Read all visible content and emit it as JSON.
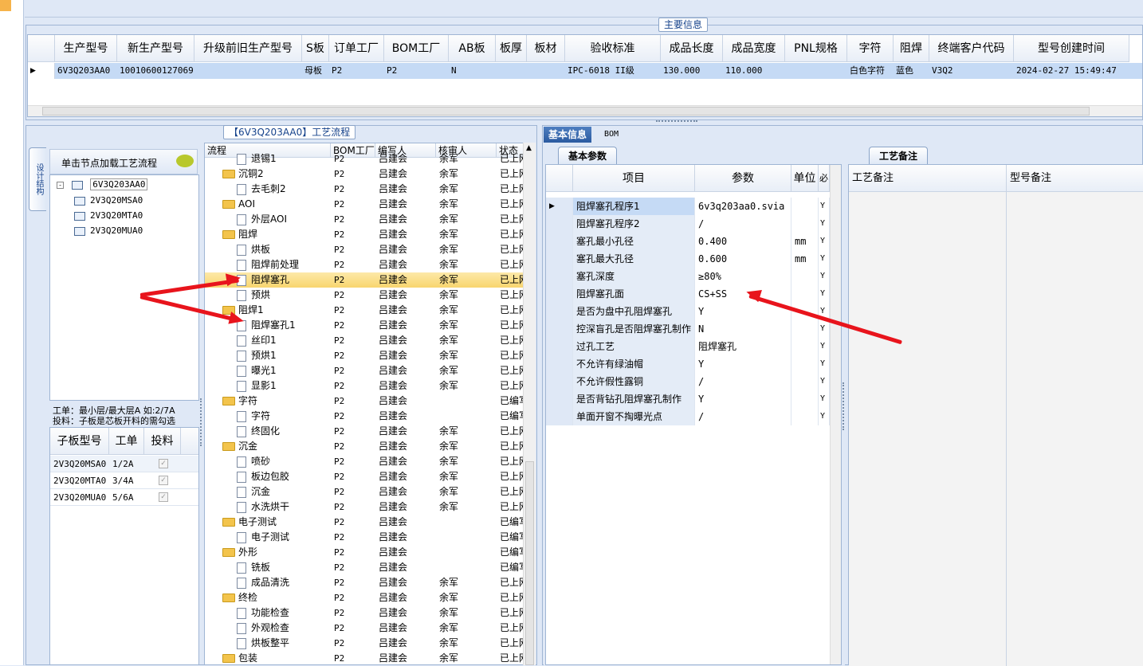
{
  "main_group": {
    "title": "主要信息"
  },
  "main_grid": {
    "headers": [
      "生产型号",
      "新生产型号",
      "升级前旧生产型号",
      "S板",
      "订单工厂",
      "BOM工厂",
      "AB板",
      "板厚",
      "板材",
      "验收标准",
      "成品长度",
      "成品宽度",
      "PNL规格",
      "字符",
      "阻焊",
      "终端客户代码",
      "型号创建时间"
    ],
    "row": [
      "6V3Q203AA0",
      "10010600127069",
      "",
      "母板",
      "P2",
      "P2",
      "N",
      "",
      "",
      "IPC-6018 II级",
      "130.000",
      "110.000",
      "",
      "白色字符",
      "蓝色",
      "V3Q2",
      "2024-02-27 15:49:47"
    ]
  },
  "process_group": {
    "title": "【6V3Q203AA0】工艺流程"
  },
  "side_tab": {
    "label": "设计结构"
  },
  "load_hint": "单击节点加载工艺流程",
  "tree": {
    "root": "6V3Q203AA0",
    "children": [
      "2V3Q20MSA0",
      "2V3Q20MTA0",
      "2V3Q20MUA0"
    ]
  },
  "note": {
    "line1": "工单：最小层/最大层A 如:2/7A",
    "line2": "投料：子板是芯板开料的需勾选"
  },
  "sub_grid": {
    "headers": [
      "子板型号",
      "工单",
      "投料"
    ],
    "rows": [
      [
        "2V3Q20MSA0",
        "1/2A"
      ],
      [
        "2V3Q20MTA0",
        "3/4A"
      ],
      [
        "2V3Q20MUA0",
        "5/6A"
      ]
    ]
  },
  "process_grid": {
    "headers": [
      "流程",
      "BOM工厂",
      "编写人",
      "核审人",
      "状态"
    ],
    "rows": [
      {
        "name": "退锡1",
        "type": "doc",
        "bom": "P2",
        "w": "吕建会",
        "r": "余军",
        "s": "已上网"
      },
      {
        "name": "沉铜2",
        "type": "folder",
        "bom": "P2",
        "w": "吕建会",
        "r": "余军",
        "s": "已上网"
      },
      {
        "name": "去毛刺2",
        "type": "doc",
        "bom": "P2",
        "w": "吕建会",
        "r": "余军",
        "s": "已上网"
      },
      {
        "name": "AOI",
        "type": "folder",
        "bom": "P2",
        "w": "吕建会",
        "r": "余军",
        "s": "已上网"
      },
      {
        "name": "外层AOI",
        "type": "doc",
        "bom": "P2",
        "w": "吕建会",
        "r": "余军",
        "s": "已上网"
      },
      {
        "name": "阻焊",
        "type": "folder",
        "bom": "P2",
        "w": "吕建会",
        "r": "余军",
        "s": "已上网"
      },
      {
        "name": "烘板",
        "type": "doc",
        "bom": "P2",
        "w": "吕建会",
        "r": "余军",
        "s": "已上网"
      },
      {
        "name": "阻焊前处理",
        "type": "doc",
        "bom": "P2",
        "w": "吕建会",
        "r": "余军",
        "s": "已上网"
      },
      {
        "name": "阻焊塞孔",
        "type": "doc",
        "bom": "P2",
        "w": "吕建会",
        "r": "余军",
        "s": "已上网",
        "sel": true
      },
      {
        "name": "预烘",
        "type": "doc",
        "bom": "P2",
        "w": "吕建会",
        "r": "余军",
        "s": "已上网"
      },
      {
        "name": "阻焊1",
        "type": "folder",
        "bom": "P2",
        "w": "吕建会",
        "r": "余军",
        "s": "已上网"
      },
      {
        "name": "阻焊塞孔1",
        "type": "doc",
        "bom": "P2",
        "w": "吕建会",
        "r": "余军",
        "s": "已上网"
      },
      {
        "name": "丝印1",
        "type": "doc",
        "bom": "P2",
        "w": "吕建会",
        "r": "余军",
        "s": "已上网"
      },
      {
        "name": "预烘1",
        "type": "doc",
        "bom": "P2",
        "w": "吕建会",
        "r": "余军",
        "s": "已上网"
      },
      {
        "name": "曝光1",
        "type": "doc",
        "bom": "P2",
        "w": "吕建会",
        "r": "余军",
        "s": "已上网"
      },
      {
        "name": "显影1",
        "type": "doc",
        "bom": "P2",
        "w": "吕建会",
        "r": "余军",
        "s": "已上网"
      },
      {
        "name": "字符",
        "type": "folder",
        "bom": "P2",
        "w": "吕建会",
        "r": "",
        "s": "已编写"
      },
      {
        "name": "字符",
        "type": "doc",
        "bom": "P2",
        "w": "吕建会",
        "r": "",
        "s": "已编写"
      },
      {
        "name": "终固化",
        "type": "doc",
        "bom": "P2",
        "w": "吕建会",
        "r": "余军",
        "s": "已上网"
      },
      {
        "name": "沉金",
        "type": "folder",
        "bom": "P2",
        "w": "吕建会",
        "r": "余军",
        "s": "已上网"
      },
      {
        "name": "喷砂",
        "type": "doc",
        "bom": "P2",
        "w": "吕建会",
        "r": "余军",
        "s": "已上网"
      },
      {
        "name": "板边包胶",
        "type": "doc",
        "bom": "P2",
        "w": "吕建会",
        "r": "余军",
        "s": "已上网"
      },
      {
        "name": "沉金",
        "type": "doc",
        "bom": "P2",
        "w": "吕建会",
        "r": "余军",
        "s": "已上网"
      },
      {
        "name": "水洗烘干",
        "type": "doc",
        "bom": "P2",
        "w": "吕建会",
        "r": "余军",
        "s": "已上网"
      },
      {
        "name": "电子测试",
        "type": "folder",
        "bom": "P2",
        "w": "吕建会",
        "r": "",
        "s": "已编写"
      },
      {
        "name": "电子测试",
        "type": "doc",
        "bom": "P2",
        "w": "吕建会",
        "r": "",
        "s": "已编写"
      },
      {
        "name": "外形",
        "type": "folder",
        "bom": "P2",
        "w": "吕建会",
        "r": "",
        "s": "已编写"
      },
      {
        "name": "铣板",
        "type": "doc",
        "bom": "P2",
        "w": "吕建会",
        "r": "",
        "s": "已编写"
      },
      {
        "name": "成品清洗",
        "type": "doc",
        "bom": "P2",
        "w": "吕建会",
        "r": "余军",
        "s": "已上网"
      },
      {
        "name": "终检",
        "type": "folder",
        "bom": "P2",
        "w": "吕建会",
        "r": "余军",
        "s": "已上网"
      },
      {
        "name": "功能检查",
        "type": "doc",
        "bom": "P2",
        "w": "吕建会",
        "r": "余军",
        "s": "已上网"
      },
      {
        "name": "外观检查",
        "type": "doc",
        "bom": "P2",
        "w": "吕建会",
        "r": "余军",
        "s": "已上网"
      },
      {
        "name": "烘板整平",
        "type": "doc",
        "bom": "P2",
        "w": "吕建会",
        "r": "余军",
        "s": "已上网"
      },
      {
        "name": "包装",
        "type": "folder",
        "bom": "P2",
        "w": "吕建会",
        "r": "余军",
        "s": "已上网"
      }
    ]
  },
  "tabs": [
    "基本信息",
    "BOM"
  ],
  "param_tab": "基本参数",
  "param_grid": {
    "headers": [
      "项目",
      "参数",
      "单位",
      "必"
    ],
    "rows": [
      [
        "阻焊塞孔程序1",
        "6v3q203aa0.svia",
        "",
        "Y"
      ],
      [
        "阻焊塞孔程序2",
        "/",
        "",
        "Y"
      ],
      [
        "塞孔最小孔径",
        "0.400",
        "mm",
        "Y"
      ],
      [
        "塞孔最大孔径",
        "0.600",
        "mm",
        "Y"
      ],
      [
        "塞孔深度",
        "≥80%",
        "",
        "Y"
      ],
      [
        "阻焊塞孔面",
        "CS+SS",
        "",
        "Y"
      ],
      [
        "是否为盘中孔阻焊塞孔",
        "Y",
        "",
        "Y"
      ],
      [
        "控深盲孔是否阻焊塞孔制作",
        "N",
        "",
        "Y"
      ],
      [
        "过孔工艺",
        "阻焊塞孔",
        "",
        "Y"
      ],
      [
        "不允许有绿油帽",
        "Y",
        "",
        "Y"
      ],
      [
        "不允许假性露铜",
        "/",
        "",
        "Y"
      ],
      [
        "是否背钻孔阻焊塞孔制作",
        "Y",
        "",
        "Y"
      ],
      [
        "单面开窗不掏曝光点",
        "/",
        "",
        "Y"
      ]
    ]
  },
  "remark_tab": "工艺备注",
  "remark_headers": [
    "工艺备注",
    "型号备注"
  ],
  "colors": {
    "highlight": "#c5daf5",
    "selected": "#f8d56e",
    "arrow": "#e8141c"
  }
}
